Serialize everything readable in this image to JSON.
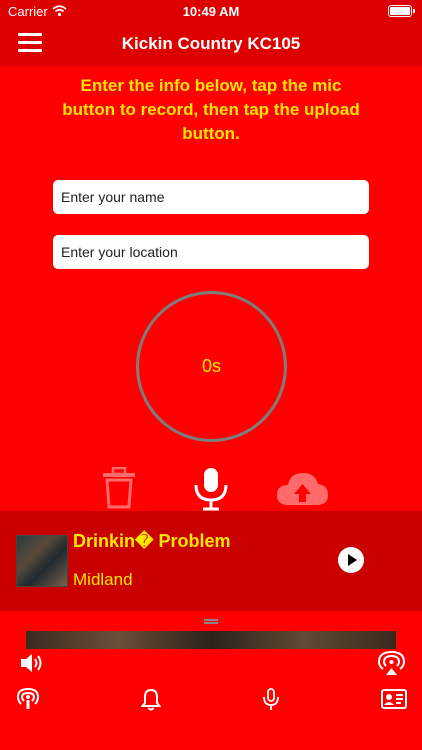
{
  "status_bar": {
    "carrier": "Carrier",
    "time": "10:49 AM"
  },
  "navbar": {
    "title": "Kickin Country KC105"
  },
  "instructions": "Enter the info below, tap the mic button to record, then tap the upload button.",
  "form": {
    "name_placeholder": "Enter your name",
    "location_placeholder": "Enter your location"
  },
  "recorder": {
    "elapsed": "0s",
    "actions": [
      "trash-icon",
      "microphone-icon",
      "cloud-upload-icon"
    ]
  },
  "now_playing": {
    "title": "Drinkin� Problem",
    "artist": "Midland"
  },
  "bottom_bar": {
    "icons": [
      "speaker-icon",
      "airplay-icon",
      "podcast-icon",
      "bell-icon",
      "microphone-icon",
      "contact-card-icon"
    ]
  },
  "colors": {
    "background": "#ff0000",
    "bar": "#dd0000",
    "now_playing_bg": "#c80000",
    "accent_text": "#ffe600",
    "ring": "#7d7d7d"
  }
}
